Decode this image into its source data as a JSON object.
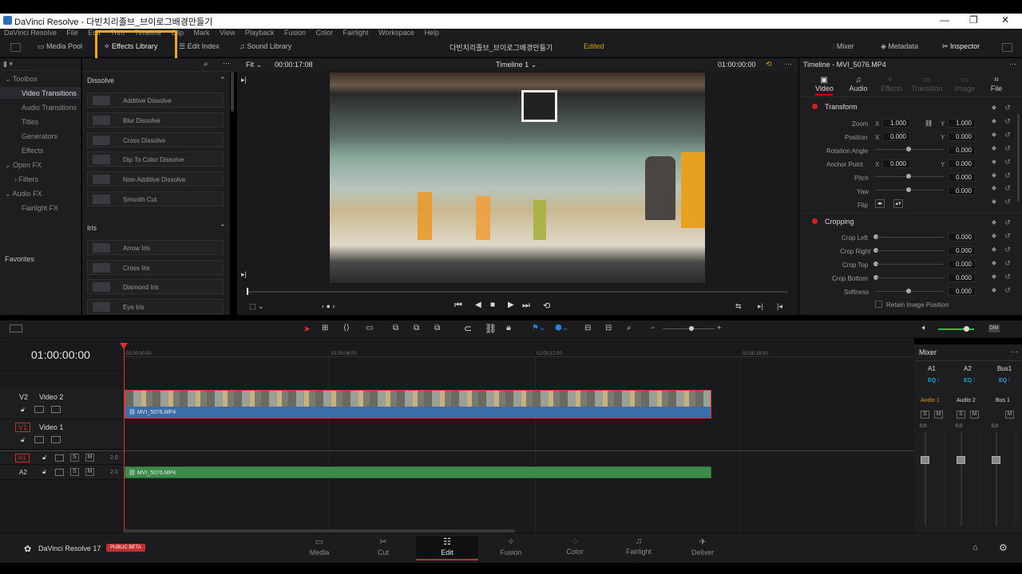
{
  "app": {
    "title": "DaVinci Resolve - 다빈치리졸브_브이로그배경만들기",
    "project_title": "다빈치리졸브_브이로그배경만들기",
    "edited": "Edited"
  },
  "menu": [
    "DaVinci Resolve",
    "File",
    "Edit",
    "Trim",
    "Timeline",
    "Clip",
    "Mark",
    "View",
    "Playback",
    "Fusion",
    "Color",
    "Fairlight",
    "Workspace",
    "Help"
  ],
  "toolbar": {
    "media_pool": "Media Pool",
    "effects_library": "Effects Library",
    "edit_index": "Edit Index",
    "sound_library": "Sound Library",
    "mixer": "Mixer",
    "metadata": "Metadata",
    "inspector": "Inspector"
  },
  "toolbox": {
    "items": [
      "Toolbox",
      "Video Transitions",
      "Audio Transitions",
      "Titles",
      "Generators",
      "Effects",
      "Open FX",
      "Filters",
      "Audio FX",
      "Fairlight FX"
    ],
    "favorites": "Favorites"
  },
  "effects": {
    "dissolve_header": "Dissolve",
    "dissolve": [
      "Additive Dissolve",
      "Blur Dissolve",
      "Cross Dissolve",
      "Dip To Color Dissolve",
      "Non-Additive Dissolve",
      "Smooth Cut"
    ],
    "iris_header": "Iris",
    "iris": [
      "Arrow Iris",
      "Cross Iris",
      "Diamond Iris",
      "Eye Iris"
    ]
  },
  "viewer": {
    "fit": "Fit",
    "timecode": "00:00:17:08",
    "timeline_name": "Timeline 1",
    "tc_right": "01:00:00:00"
  },
  "inspector": {
    "title": "Timeline - MVI_5076.MP4",
    "tabs": [
      "Video",
      "Audio",
      "Effects",
      "Transition",
      "Image",
      "File"
    ],
    "transform": "Transform",
    "zoom": "Zoom",
    "position": "Position",
    "rotation": "Rotation Angle",
    "anchor": "Anchor Point",
    "pitch": "Pitch",
    "yaw": "Yaw",
    "flip": "Flip",
    "zoom_x": "1.000",
    "zoom_y": "1.000",
    "pos_x": "0.000",
    "pos_y": "0.000",
    "rot": "0.000",
    "anc_x": "0.000",
    "anc_y": "0.000",
    "pitch_v": "0.000",
    "yaw_v": "0.000",
    "cropping": "Cropping",
    "crop_left": "Crop Left",
    "crop_right": "Crop Right",
    "crop_top": "Crop Top",
    "crop_bottom": "Crop Bottom",
    "softness": "Softness",
    "crop_vals": [
      "0.000",
      "0.000",
      "0.000",
      "0.000",
      "0.000"
    ],
    "retain": "Retain Image Position"
  },
  "timeline": {
    "timecode": "01:00:00:00",
    "ruler": [
      "01:00:00:00",
      "01:00:06:00",
      "01:00:12:00",
      "01:00:18:00"
    ],
    "v2": "V2",
    "v2_name": "Video 2",
    "v1": "V1",
    "v1_name": "Video 1",
    "a1": "A1",
    "a2": "A2",
    "a_level": "2.0",
    "clip_name": "MVI_5076.MP4"
  },
  "mixer": {
    "title": "Mixer",
    "channels": [
      "A1",
      "A2",
      "Bus1"
    ],
    "eq": "EQ",
    "names": [
      "Audio 1",
      "Audio 2",
      "Bus 1"
    ],
    "level": "0.0"
  },
  "pages": [
    "Media",
    "Cut",
    "Edit",
    "Fusion",
    "Color",
    "Fairlight",
    "Deliver"
  ],
  "brand": {
    "name": "DaVinci Resolve 17",
    "badge": "PUBLIC BETA"
  }
}
